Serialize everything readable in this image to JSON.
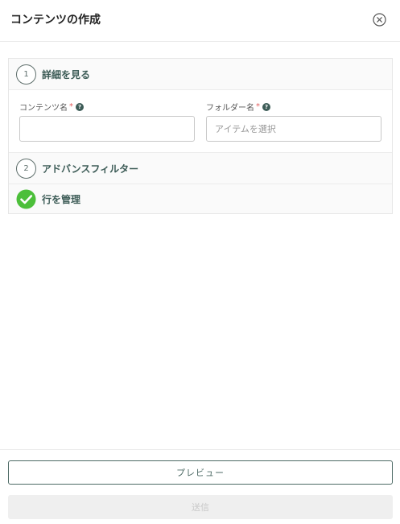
{
  "header": {
    "title": "コンテンツの作成",
    "close_icon": "close-circle-icon"
  },
  "steps": [
    {
      "number": "1",
      "label": "詳細を見る",
      "expanded": true,
      "fields": [
        {
          "label": "コンテンツ名",
          "required": true,
          "help": "?",
          "value": "",
          "placeholder": ""
        },
        {
          "label": "フォルダー名",
          "required": true,
          "help": "?",
          "value": "",
          "placeholder": "アイテムを選択"
        }
      ]
    },
    {
      "number": "2",
      "label": "アドバンスフィルター",
      "expanded": false
    },
    {
      "number": "",
      "label": "行を管理",
      "completed": true,
      "icon": "checkmark-circle-icon",
      "accent": "#4cbf3a"
    }
  ],
  "footer": {
    "preview_label": "プレビュー",
    "submit_label": "送信",
    "submit_disabled": true
  }
}
